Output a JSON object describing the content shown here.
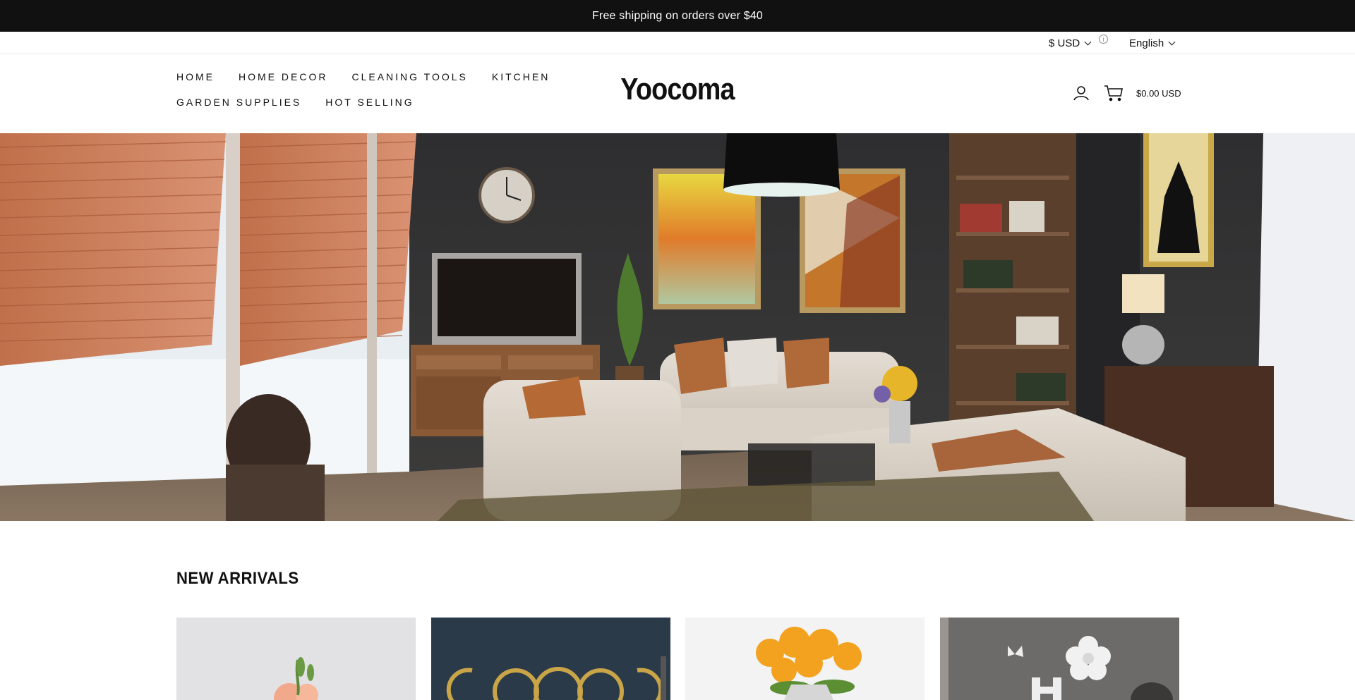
{
  "announcement": {
    "text": "Free shipping on orders over $40"
  },
  "utility": {
    "currency": "$ USD",
    "language": "English"
  },
  "nav": {
    "row1": [
      "HOME",
      "HOME DECOR",
      "CLEANING TOOLS",
      "KITCHEN"
    ],
    "row2": [
      "GARDEN SUPPLIES",
      "HOT SELLING"
    ]
  },
  "brand": {
    "logo_text": "Yoocoma"
  },
  "header": {
    "cart_total": "$0.00 USD",
    "icons": [
      "user-icon",
      "cart-icon"
    ]
  },
  "hero": {
    "image": "living-room-interior"
  },
  "new_arrivals": {
    "title": "NEW ARRIVALS",
    "products": [
      "flower-arrangement",
      "moon-phase-wall-decor",
      "sunflower-bouquet",
      "letter-h-wall-decal"
    ]
  },
  "colors": {
    "announcement_bg": "#111111",
    "text": "#111111",
    "background": "#ffffff"
  }
}
